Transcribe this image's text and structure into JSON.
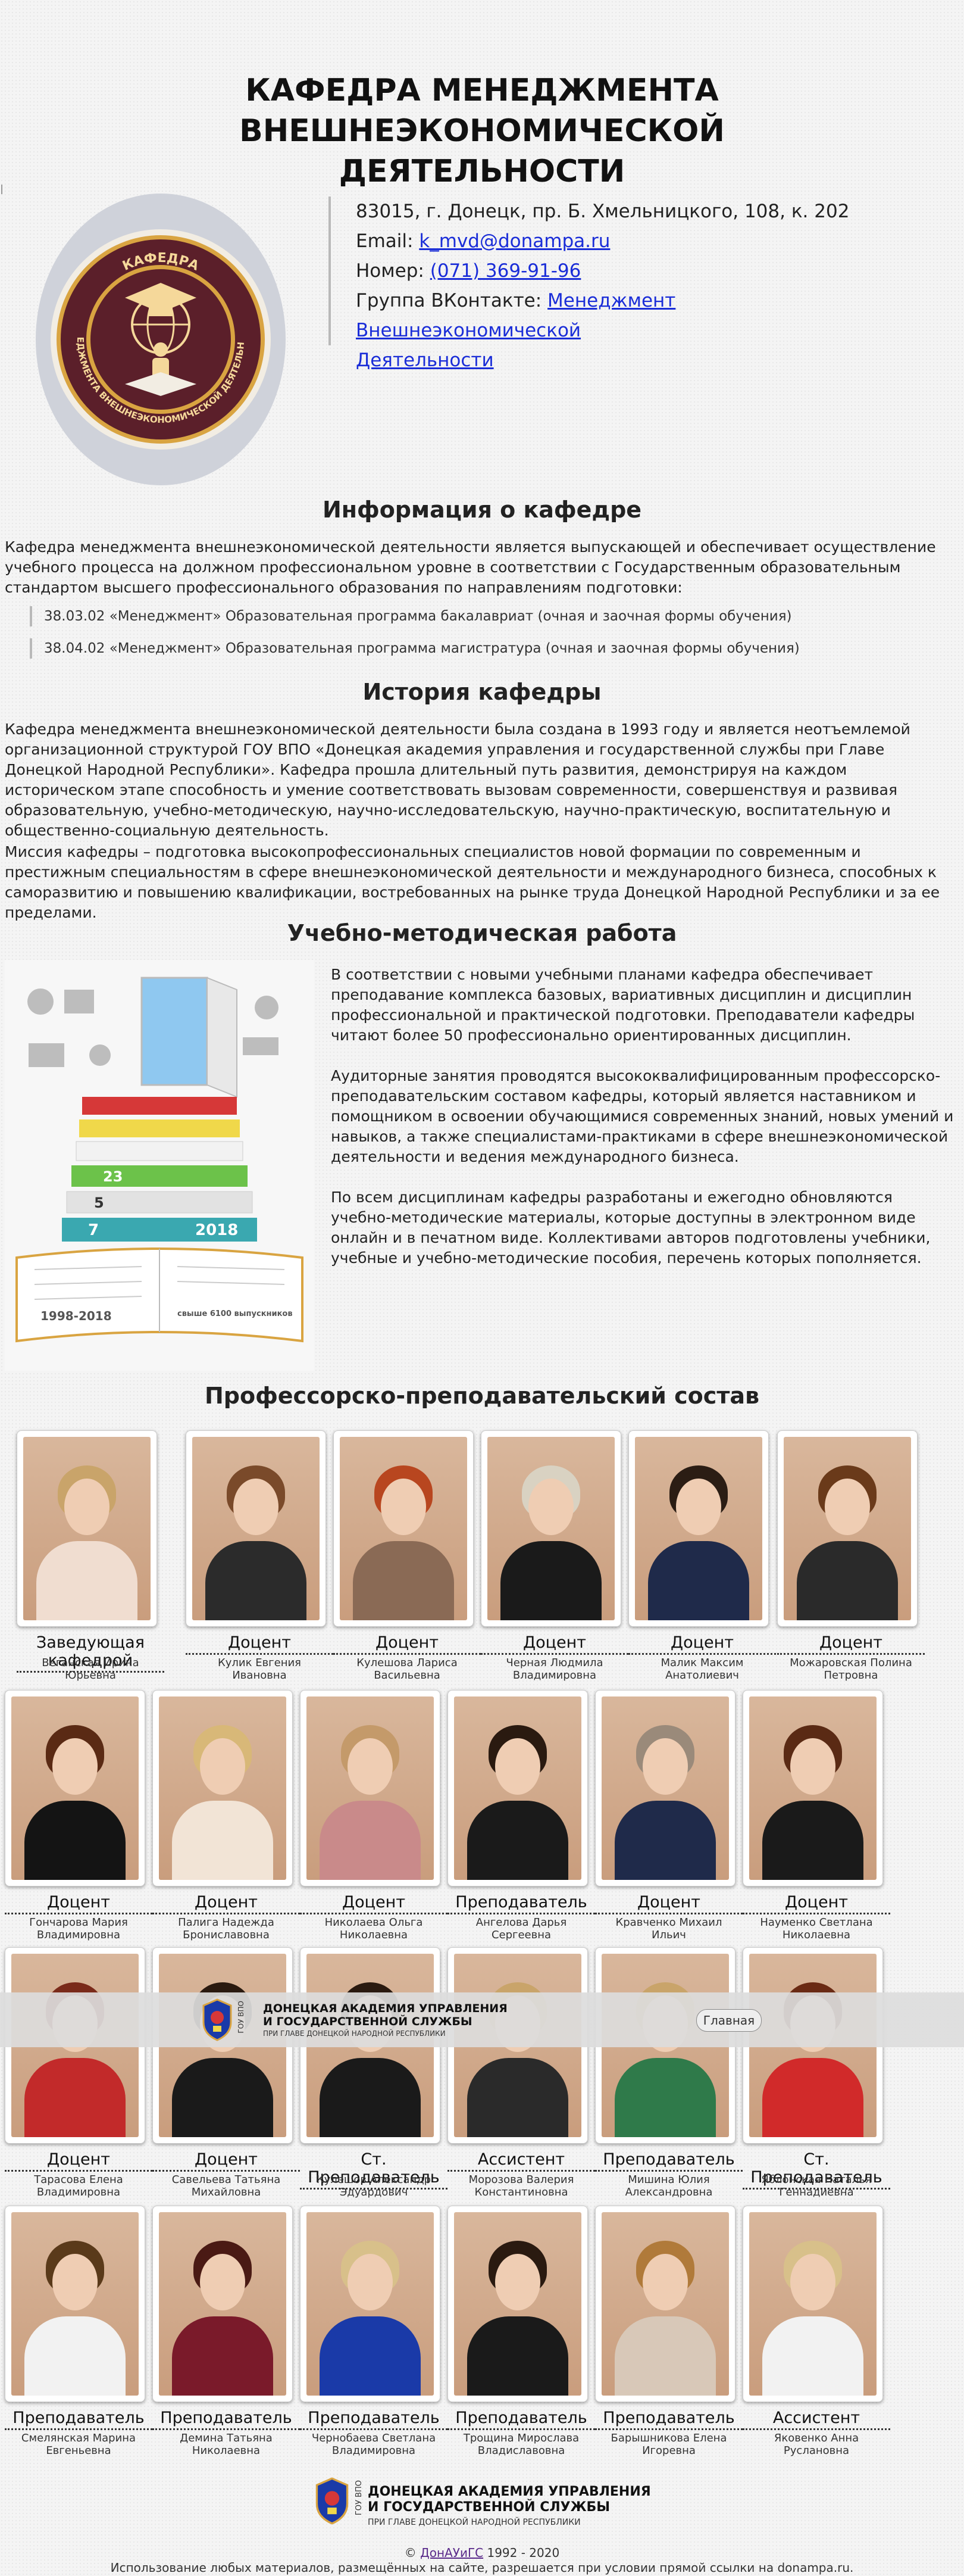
{
  "header": {
    "title_line1": "КАФЕДРА МЕНЕДЖМЕНТА ВНЕШНЕЭКОНОМИЧЕСКОЙ",
    "title_line2": "ДЕЯТЕЛЬНОСТИ"
  },
  "logo": {
    "ring_text_top": "КАФЕДРА",
    "ring_text_bottom": "МЕНЕДЖМЕНТА ВНЕШНЕЭКОНОМИЧЕСКОЙ ДЕЯТЕЛЬНОСТИ",
    "ring_color": "#5b1f2a",
    "gold": "#d9a441"
  },
  "contacts": {
    "address": "83015, г. Донецк, пр. Б. Хмельницкого, 108, к. 202",
    "email_label": "Email: ",
    "email": "k_mvd@donampa.ru",
    "phone_label": "Номер: ",
    "phone": "(071) 369-91-96",
    "vk_label": "Группа ВКонтакте: ",
    "vk_line1": "Менеджмент Внешнеэкономической",
    "vk_line2": "Деятельности"
  },
  "info": {
    "title": "Информация о кафедре",
    "text": "Кафедра менеджмента внешнеэкономической деятельности является выпускающей и обеспечивает осуществление учебного процесса на должном профессиональном уровне в соответствии с Государственным образовательным стандартом высшего профессионального образования по направлениям подготовки:",
    "programs": [
      "38.03.02 «Менеджмент» Образовательная программа бакалавриат (очная и заочная формы обучения)",
      "38.04.02 «Менеджмент» Образовательная программа магистратура (очная и заочная формы обучения)"
    ]
  },
  "history": {
    "title": "История кафедры",
    "text1": "Кафедра менеджмента внешнеэкономической деятельности была создана в 1993 году и является неотъемлемой организационной структурой ГОУ ВПО «Донецкая академия управления и государственной службы при Главе Донецкой Народной Республики». Кафедра прошла длительный путь развития, демонстрируя на каждом историческом этапе способность и умение соответствовать вызовам современности, совершенствуя и развивая образовательную, учебно-методическую, научно-исследовательскую, научно-практическую, воспитательную и общественно-социальную деятельность.",
    "text2": "Миссия кафедры – подготовка высокопрофессиональных специалистов новой формации по современным и престижным специальностям в сфере внешнеэкономической деятельности и международного бизнеса, способных к саморазвитию и повышению квалификации, востребованных на рынке труда Донецкой Народной Республики и за ее пределами."
  },
  "metodic": {
    "title": "Учебно-методическая работа",
    "p1": "В соответствии с новыми учебными планами кафедра обеспечивает преподавание комплекса базовых, вариативных дисциплин и дисциплин профессиональной и практической подготовки. Преподаватели кафедры читают более 50 профессионально ориентированных дисциплин.",
    "p2": "Аудиторные занятия проводятся высококвалифицированным профессорско-преподавательским составом кафедры, который является наставником и помощником в освоении обучающимися современных знаний, новых умений и навыков, а также специалистами-практиками в сфере внешнеэкономической деятельности и ведения международного бизнеса.",
    "p3": "По всем дисциплинам кафедры разработаны и ежегодно обновляются учебно-методические материалы, которые доступны в электронном виде онлайн и в печатном виде. Коллективами авторов подготовлены учебники, учебные и учебно-методические пособия, перечень которых пополняется.",
    "img_years": "1998-2018",
    "img_graduates": "свыше 6100 выпускников",
    "img_2018": "2018",
    "img_23": "23",
    "img_5": "5",
    "img_7": "7"
  },
  "staff": {
    "title": "Профессорско-преподавательский состав",
    "members": [
      {
        "role": "Заведующая кафедрой",
        "name1": "Веганская Ирина",
        "name2": "Юрьевна",
        "hair": "#c9a46a",
        "torso": "#f0ddd0"
      },
      {
        "role": "Доцент",
        "name1": "Кулик Евгения",
        "name2": "Ивановна",
        "hair": "#7a4a2a",
        "torso": "#2b2b2b"
      },
      {
        "role": "Доцент",
        "name1": "Кулешова Лариса",
        "name2": "Васильевна",
        "hair": "#b8461f",
        "torso": "#8a6a55"
      },
      {
        "role": "Доцент",
        "name1": "Черная Людмила",
        "name2": "Владимировна",
        "hair": "#d9d2c2",
        "torso": "#1a1a1a"
      },
      {
        "role": "Доцент",
        "name1": "Малик Максим",
        "name2": "Анатолиевич",
        "hair": "#2b1d14",
        "torso": "#1f2a4a"
      },
      {
        "role": "Доцент",
        "name1": "Можаровская Полина",
        "name2": "Петровна",
        "hair": "#6a3a1a",
        "torso": "#2a2a2a"
      },
      {
        "role": "Доцент",
        "name1": "Гончарова Мария",
        "name2": "Владимировна",
        "hair": "#5a2a14",
        "torso": "#141414"
      },
      {
        "role": "Доцент",
        "name1": "Палига Надежда",
        "name2": "Брониславовна",
        "hair": "#d8b878",
        "torso": "#f2e4d6"
      },
      {
        "role": "Доцент",
        "name1": "Николаева Ольга",
        "name2": "Николаевна",
        "hair": "#c49a6a",
        "torso": "#c98a8a"
      },
      {
        "role": "Преподаватель",
        "name1": "Ангелова Дарья",
        "name2": "Сергеевна",
        "hair": "#2a1a10",
        "torso": "#1a1a1a"
      },
      {
        "role": "Доцент",
        "name1": "Кравченко Михаил",
        "name2": "Ильич",
        "hair": "#9a8a7a",
        "torso": "#1f2a4a"
      },
      {
        "role": "Доцент",
        "name1": "Науменко Светлана",
        "name2": "Николаевна",
        "hair": "#5a2a14",
        "torso": "#1a1a1a"
      },
      {
        "role": "Доцент",
        "name1": "Тарасова Елена",
        "name2": "Владимировна",
        "hair": "#7a2a1a",
        "torso": "#c22a2a"
      },
      {
        "role": "Доцент",
        "name1": "Савельева Татьяна",
        "name2": "Михайловна",
        "hair": "#2a1a10",
        "torso": "#1a1a1a"
      },
      {
        "role": "Ст. Преподаватель",
        "name1": "Кулешов Александр",
        "name2": "Эдуардович",
        "hair": "#2a1a10",
        "torso": "#1a1a1a"
      },
      {
        "role": "Ассистент",
        "name1": "Морозова Валерия",
        "name2": "Константиновна",
        "hair": "#c9a46a",
        "torso": "#2a2a2a"
      },
      {
        "role": "Преподаватель",
        "name1": "Мишина Юлия",
        "name2": "Александровна",
        "hair": "#c9a46a",
        "torso": "#2f7a4a"
      },
      {
        "role": "Ст. Преподаватель",
        "name1": "Яблонская Наталья",
        "name2": "Геннадиевна",
        "hair": "#6a2a14",
        "torso": "#d12a2a"
      },
      {
        "role": "Преподаватель",
        "name1": "Смелянская Марина",
        "name2": "Евгеньевна",
        "hair": "#5a3a1a",
        "torso": "#f2f2f2"
      },
      {
        "role": "Преподаватель",
        "name1": "Демина Татьяна",
        "name2": "Николаевна",
        "hair": "#4a1a14",
        "torso": "#7a1a2a"
      },
      {
        "role": "Преподаватель",
        "name1": "Чернобаева Светлана",
        "name2": "Владимировна",
        "hair": "#d8c08a",
        "torso": "#1a3aa8"
      },
      {
        "role": "Преподаватель",
        "name1": "Трощина Мирослава",
        "name2": "Владиславовна",
        "hair": "#2a1a10",
        "torso": "#1a1a1a"
      },
      {
        "role": "Преподаватель",
        "name1": "Барышникова Елена",
        "name2": "Игоревна",
        "hair": "#b07a3a",
        "torso": "#d8c8b8"
      },
      {
        "role": "Ассистент",
        "name1": "Яковенко Анна",
        "name2": "Руслановна",
        "hair": "#d8c08a",
        "torso": "#f2f2f2"
      }
    ]
  },
  "banner": {
    "vertical": "ГОУ ВПО",
    "line1": "ДОНЕЦКАЯ АКАДЕМИЯ УПРАВЛЕНИЯ",
    "line2": "И ГОСУДАРСТВЕННОЙ СЛУЖБЫ",
    "line3": "ПРИ ГЛАВЕ ДОНЕЦКОЙ НАРОДНОЙ РЕСПУБЛИКИ",
    "home_button": "Главная"
  },
  "footer": {
    "vertical": "ГОУ ВПО",
    "line1": "ДОНЕЦКАЯ АКАДЕМИЯ УПРАВЛЕНИЯ",
    "line2": "И ГОСУДАРСТВЕННОЙ СЛУЖБЫ",
    "line3": "ПРИ ГЛАВЕ ДОНЕЦКОЙ НАРОДНОЙ РЕСПУБЛИКИ",
    "copy_prefix": "© ",
    "copy_link": "ДонАУиГС",
    "copy_years": " 1992 - 2020",
    "note": "Использование любых материалов, размещённых на сайте, разрешается при условии прямой ссылки на donampa.ru."
  }
}
